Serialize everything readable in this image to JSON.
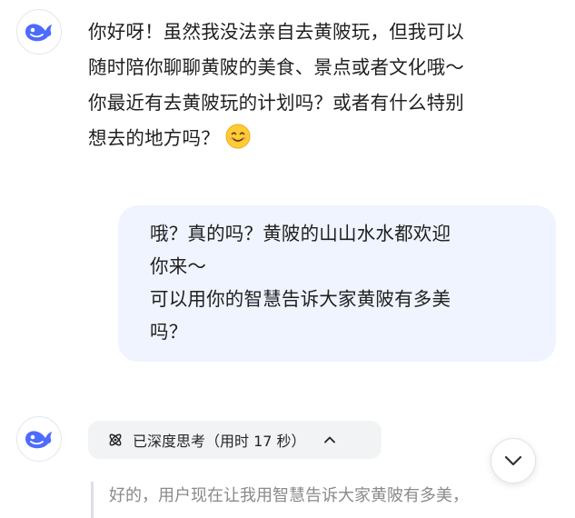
{
  "assistant_message": {
    "lines": [
      "你好呀！虽然我没法亲自去黄陂玩，但我可以",
      "随时陪你聊聊黄陂的美食、景点或者文化哦～",
      "你最近有去黄陂玩的计划吗？或者有什么特别",
      "想去的地方吗？"
    ],
    "emoji": "smiling-face-emoji"
  },
  "user_message": {
    "lines": [
      "哦？真的吗？黄陂的山山水水都欢迎",
      "你来～",
      "可以用你的智慧告诉大家黄陂有多美",
      "吗？"
    ]
  },
  "thinking": {
    "label": "已深度思考（用时 17 秒）",
    "excerpt": "好的，用户现在让我用智慧告诉大家黄陂有多美，"
  },
  "colors": {
    "brand": "#4d6bfe",
    "user_bubble": "#eff4fe",
    "chip_bg": "#f2f3f5"
  }
}
